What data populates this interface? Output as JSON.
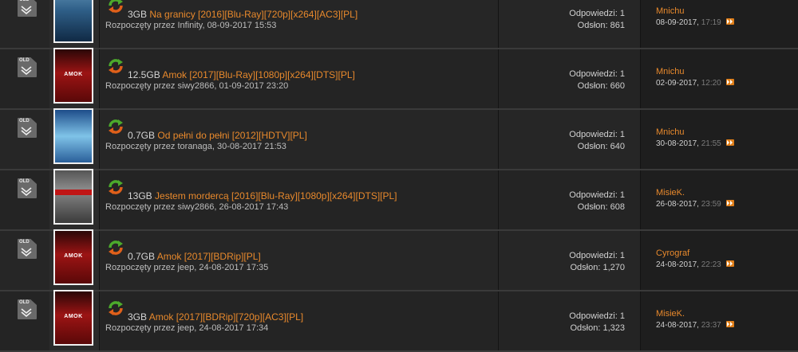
{
  "ui": {
    "replies_label": "Odpowiedzi:",
    "views_label": "Odsłon:",
    "started_by_prefix": "Rozpoczęty przez"
  },
  "colors": {
    "accent": "#e8892c",
    "background": "#242424"
  },
  "icons": {
    "file_badge_text": "OLD"
  },
  "threads": [
    {
      "size": "3GB",
      "title": "Na granicy [2016][Blu-Ray][720p][x264][AC3][PL]",
      "poster": "na-granicy-poster",
      "started_by": "Rozpoczęty przez Infinity, 08-09-2017 15:53",
      "replies": "1",
      "views": "861",
      "last_user": "Mnichu",
      "last_date": "08-09-2017,",
      "last_time": "17:19"
    },
    {
      "size": "12.5GB",
      "title": "Amok [2017][Blu-Ray][1080p][x264][DTS][PL]",
      "poster": "amok-poster",
      "started_by": "Rozpoczęty przez siwy2866, 01-09-2017 23:20",
      "replies": "1",
      "views": "660",
      "last_user": "Mnichu",
      "last_date": "02-09-2017,",
      "last_time": "12:20"
    },
    {
      "size": "0.7GB",
      "title": "Od pełni do pełni [2012][HDTV][PL]",
      "poster": "od-pelni-do-pelni-poster",
      "started_by": "Rozpoczęty przez toranaga, 30-08-2017 21:53",
      "replies": "1",
      "views": "640",
      "last_user": "Mnichu",
      "last_date": "30-08-2017,",
      "last_time": "21:55"
    },
    {
      "size": "13GB",
      "title": "Jestem mordercą [2016][Blu-Ray][1080p][x264][DTS][PL]",
      "poster": "jestem-morderca-poster",
      "started_by": "Rozpoczęty przez siwy2866, 26-08-2017 17:43",
      "replies": "1",
      "views": "608",
      "last_user": "MisieK.",
      "last_date": "26-08-2017,",
      "last_time": "23:59"
    },
    {
      "size": "0.7GB",
      "title": "Amok [2017][BDRip][PL]",
      "poster": "amok-poster",
      "started_by": "Rozpoczęty przez jeep, 24-08-2017 17:35",
      "replies": "1",
      "views": "1,270",
      "last_user": "Cyrograf",
      "last_date": "24-08-2017,",
      "last_time": "22:23"
    },
    {
      "size": "3GB",
      "title": "Amok [2017][BDRip][720p][AC3][PL]",
      "poster": "amok-poster",
      "started_by": "Rozpoczęty przez jeep, 24-08-2017 17:34",
      "replies": "1",
      "views": "1,323",
      "last_user": "MisieK.",
      "last_date": "24-08-2017,",
      "last_time": "23:37"
    }
  ]
}
